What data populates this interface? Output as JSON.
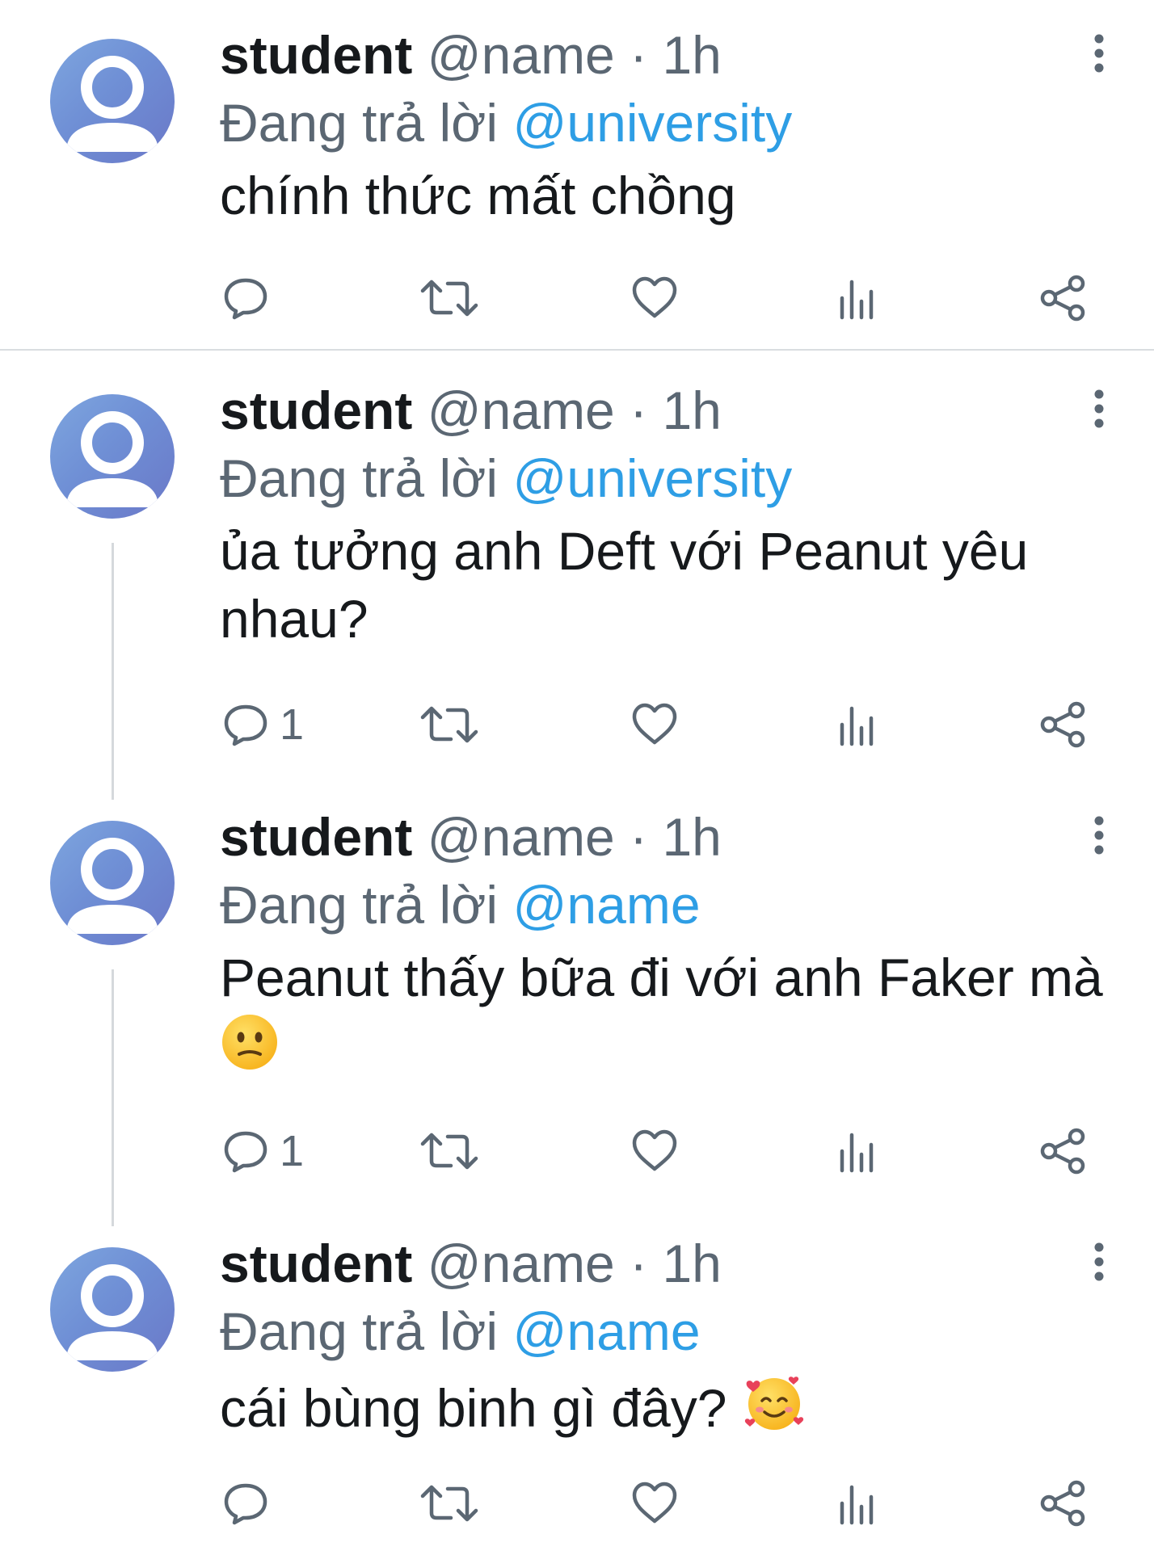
{
  "tweets": [
    {
      "username": "student",
      "handle": "@name",
      "separator": "·",
      "time": "1h",
      "reply_prefix": "Đang trả lời",
      "reply_to": "@university",
      "text": "chính thức mất chồng",
      "emoji": "",
      "reply_count": ""
    },
    {
      "username": "student",
      "handle": "@name",
      "separator": "·",
      "time": "1h",
      "reply_prefix": "Đang trả lời",
      "reply_to": "@university",
      "text": "ủa tưởng anh Deft với Peanut yêu nhau?",
      "emoji": "",
      "reply_count": "1"
    },
    {
      "username": "student",
      "handle": "@name",
      "separator": "·",
      "time": "1h",
      "reply_prefix": "Đang trả lời",
      "reply_to": "@name",
      "text": "Peanut thấy bữa đi với anh Faker mà ",
      "emoji": "confused-face",
      "reply_count": "1"
    },
    {
      "username": "student",
      "handle": "@name",
      "separator": "·",
      "time": "1h",
      "reply_prefix": "Đang trả lời",
      "reply_to": "@name",
      "text": "cái bùng binh gì đây? ",
      "emoji": "smiling-face-with-hearts",
      "reply_count": ""
    }
  ],
  "icons": {
    "avatar": "default-user-avatar",
    "more": "more-vertical-icon",
    "reply": "reply-icon",
    "retweet": "retweet-icon",
    "like": "heart-icon",
    "views": "views-icon",
    "share": "share-icon"
  },
  "colors": {
    "text": "#16191c",
    "secondary": "#5b6773",
    "mention": "#2e9ee5",
    "divider": "#d9dde0"
  }
}
